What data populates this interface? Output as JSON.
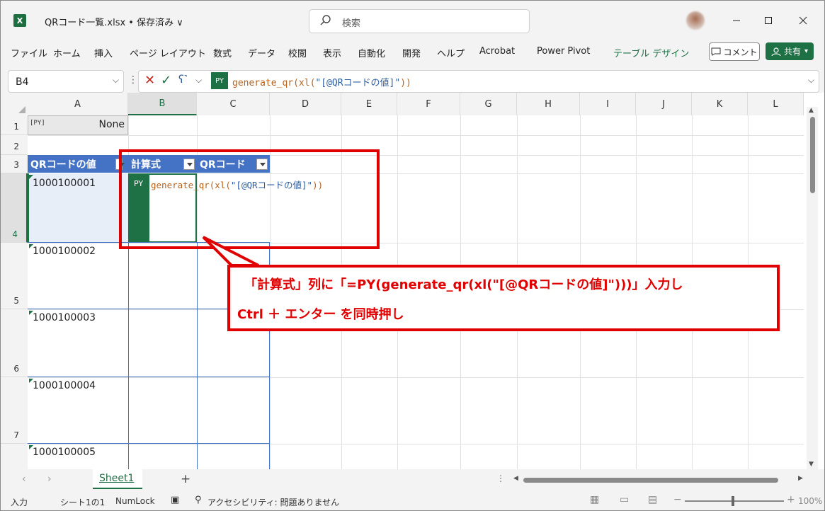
{
  "titlebar": {
    "file_name": "QRコード一覧.xlsx • 保存済み ∨",
    "search_placeholder": "検索",
    "app_logo": "X"
  },
  "menu": {
    "items": [
      "ファイル",
      "ホーム",
      "挿入",
      "ページ レイアウト",
      "数式",
      "データ",
      "校閲",
      "表示",
      "自動化",
      "開発",
      "ヘルプ",
      "Acrobat",
      "Power Pivot",
      "テーブル デザイン"
    ],
    "comment_label": "コメント",
    "share_label": "共有"
  },
  "formula_bar": {
    "name_box": "B4",
    "py_badge": "PY",
    "formula_prefix": "generate_qr(xl(",
    "formula_string": "\"[@QRコードの値]\"",
    "formula_suffix": "))"
  },
  "columns": [
    "A",
    "B",
    "C",
    "D",
    "E",
    "F",
    "G",
    "H",
    "I",
    "J",
    "K",
    "L"
  ],
  "rows": [
    "1",
    "2",
    "3",
    "4",
    "5",
    "6",
    "7"
  ],
  "cells": {
    "a1_badge": "[PY]",
    "a1_value": "None",
    "table_headers": [
      "QRコードの値",
      "計算式",
      "QRコード"
    ],
    "a_values": [
      "1000100001",
      "1000100002",
      "1000100003",
      "1000100004",
      "1000100005"
    ],
    "b4_badge": "PY",
    "b4_formula_prefix": "generate_qr(xl(",
    "b4_formula_string": "\"[@QRコードの値]\"",
    "b4_formula_suffix": "))"
  },
  "callout": {
    "line1": "「計算式」列に「=PY(generate_qr(xl(\"[@QRコードの値]\")))」入力し",
    "line2": "Ctrl ＋ エンター を同時押し",
    "color": "#e00000"
  },
  "sheet_tabs": {
    "active": "Sheet1",
    "add": "+"
  },
  "status": {
    "mode": "入力",
    "sheet_pos": "シート1の1",
    "numlock": "NumLock",
    "accessibility": "アクセシビリティ: 問題ありません",
    "zoom": "100%"
  },
  "colors": {
    "excel_green": "#1e7145",
    "table_header": "#4472c4"
  }
}
